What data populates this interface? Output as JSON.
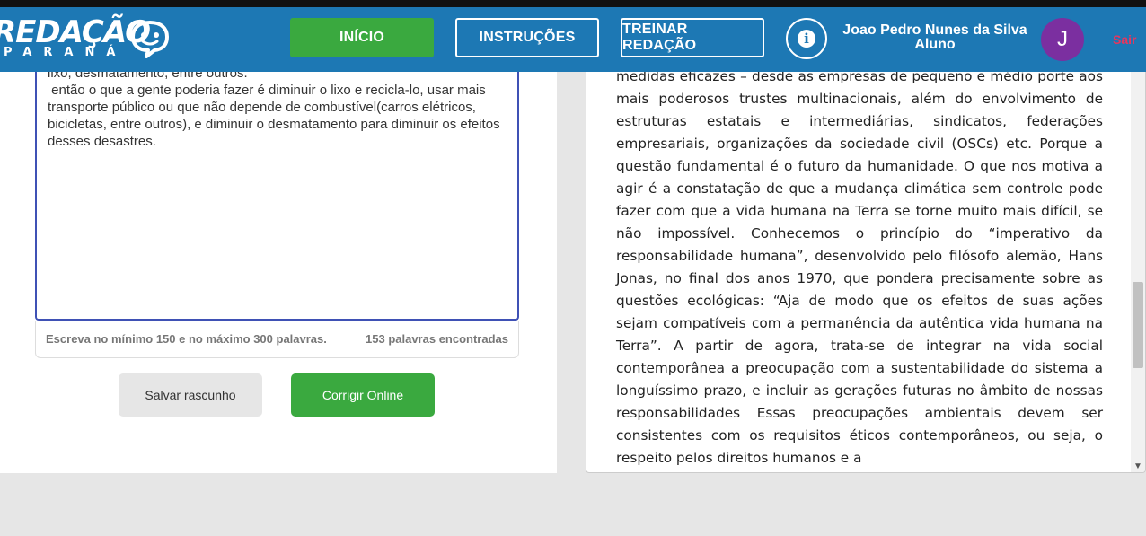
{
  "header": {
    "logo_text": "REDAÇÃO",
    "logo_sub": "PARANÁ",
    "nav": [
      {
        "label": "INÍCIO"
      },
      {
        "label": "INSTRUÇÕES"
      },
      {
        "label": "TREINAR REDAÇÃO"
      }
    ],
    "info_icon": "i",
    "user_name": "Joao Pedro Nunes da Silva",
    "user_role": "Aluno",
    "avatar_letter": "J",
    "logout_label": "Sair"
  },
  "editor": {
    "text": "lixo, desmatamento, entre outros.\n então o que a gente poderia fazer é diminuir o lixo e recicla-lo, usar mais transporte público ou que não depende de combustível(carros elétricos, bicicletas, entre outros), e diminuir o desmatamento para diminuir os efeitos desses desastres.",
    "hint": "Escreva no mínimo 150 e no máximo 300 palavras.",
    "word_count": "153 palavras encontradas"
  },
  "actions": {
    "save_label": "Salvar rascunho",
    "correct_label": "Corrigir Online"
  },
  "reference": {
    "text": "medidas eficazes – desde as empresas de pequeno e médio porte aos mais poderosos trustes multinacionais, além do envolvimento de estruturas estatais e intermediárias, sindicatos, federações empresariais, organizações da sociedade civil (OSCs) etc. Porque a questão fundamental é o futuro da humanidade. O que nos motiva a agir é a constatação de que a mudança climática sem controle pode fazer com que a vida humana na Terra se torne muito mais difícil, se não impossível. Conhecemos o princípio do “imperativo da responsabilidade humana”, desenvolvido pelo filósofo alemão, Hans Jonas, no final dos anos 1970, que pondera precisamente sobre as questões ecológicas: “Aja de modo que os efeitos de suas ações sejam compatíveis com a permanência da autêntica vida humana na Terra”. A partir de agora, trata-se de integrar na vida social contemporânea a preocupação com a sustentabilidade do sistema a longuíssimo prazo, e incluir as gerações futuras no âmbito de nossas responsabilidades Essas preocupações ambientais devem ser consistentes com os requisitos éticos contemporâneos, ou seja, o respeito pelos direitos humanos e a"
  },
  "colors": {
    "header_bg": "#1d78b4",
    "accent_green": "#3aa93f",
    "avatar_bg": "#7b2fa0",
    "logout": "#e8365d"
  }
}
